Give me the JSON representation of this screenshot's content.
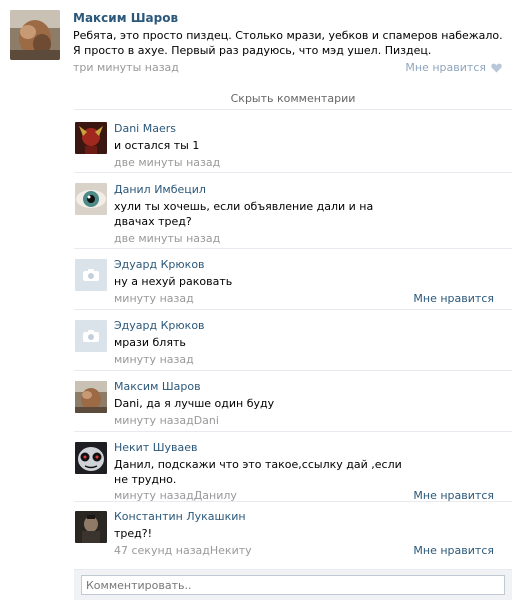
{
  "post": {
    "author": "Максим Шаров",
    "text": "Ребята, это просто пиздец. Столько мрази, уебков и спамеров набежало. Я просто в ахуе. Первый раз радуюсь, что мэд ушел. Пиздец.",
    "time": "три минуты назад",
    "like_label": "Мне нравится"
  },
  "hide_comments_label": "Скрыть комментарии",
  "comments": [
    {
      "author": "Dani Maers",
      "text": "и остался ты 1",
      "time": "две минуты назад",
      "like": ""
    },
    {
      "author": "Данил Имбецил",
      "text": "хули ты хочешь, если объявление дали и на двачах тред?",
      "time": "две минуты назад",
      "like": ""
    },
    {
      "author": "Эдуард Крюков",
      "text": "ну а нехуй раковать",
      "time": "минуту назад",
      "like": "Мне нравится"
    },
    {
      "author": "Эдуард Крюков",
      "text": "мрази блять",
      "time": "минуту назад",
      "like": ""
    },
    {
      "author": "Максим Шаров",
      "text": "Dani, да я лучше один буду",
      "time": "минуту назадDani",
      "like": ""
    },
    {
      "author": "Некит Шуваев",
      "text": "Данил, подскажи что это такое,ссылку дай ,если не трудно.",
      "time": "минуту назадДанилу",
      "like": "Мне нравится"
    },
    {
      "author": "Константин Лукашкин",
      "text": "тред?!",
      "time": "47 секунд назадНекиту",
      "like": "Мне нравится"
    }
  ],
  "comment_input": {
    "placeholder": "Комментировать.."
  }
}
